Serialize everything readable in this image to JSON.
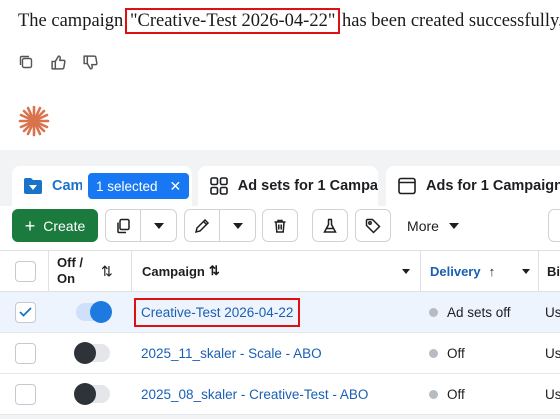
{
  "message": {
    "prefix": "The campaign ",
    "highlight": "\"Creative-Test 2026-04-22\"",
    "suffix": " has been created successfully."
  },
  "message_actions": [
    "copy-icon",
    "thumbs-up-icon",
    "thumbs-down-icon"
  ],
  "tabs": {
    "campaigns_label": "Cam",
    "selected_label": "1 selected",
    "clear_symbol": "✕",
    "adsets_label": "Ad sets for 1 Campa",
    "ads_label": "Ads for 1 Campaign"
  },
  "toolbar": {
    "create_label": "Create",
    "more_label": "More"
  },
  "table": {
    "headers": {
      "onoff": "Off / On",
      "onoff_sort": "⇅",
      "campaign": "Campaign",
      "campaign_sort": "⇅",
      "delivery": "Delivery",
      "delivery_sort": "↑",
      "next_col": "Bi"
    },
    "rows": [
      {
        "checked": true,
        "on": true,
        "campaign": "Creative-Test 2026-04-22",
        "delivery": "Ad sets off",
        "next": "Us"
      },
      {
        "checked": false,
        "on": false,
        "campaign": "2025_11_skaler - Scale - ABO",
        "delivery": "Off",
        "next": "Us"
      },
      {
        "checked": false,
        "on": false,
        "campaign": "2025_08_skaler - Creative-Test - ABO",
        "delivery": "Off",
        "next": "Us"
      }
    ]
  },
  "colors": {
    "accent": "#1877f2",
    "create_green": "#1b7a3d",
    "highlight_red": "#e01010",
    "spark": "#d9734e"
  }
}
